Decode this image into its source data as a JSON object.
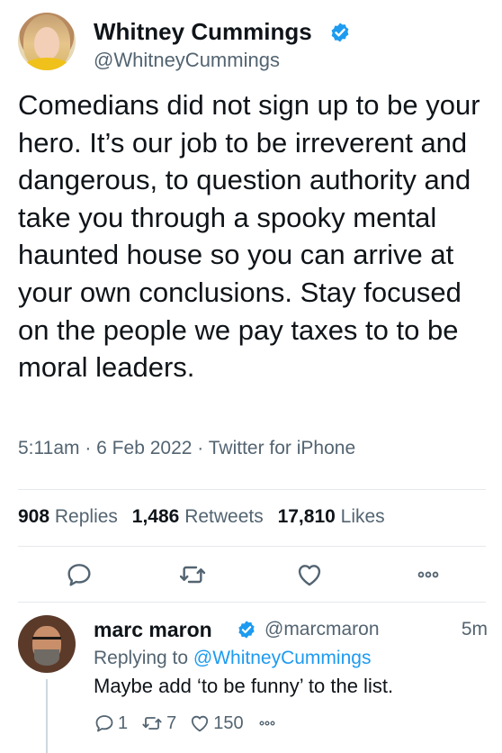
{
  "tweet": {
    "author_name": "Whitney Cummings",
    "author_handle": "@WhitneyCummings",
    "text": "Comedians did not sign up to be your hero. It’s our job to be irreverent and dangerous, to question authority and take you through a spooky mental haunted house so you can arrive at your own conclusions. Stay focused on the people we pay taxes to to be moral leaders.",
    "time": "5:11am",
    "date": "6 Feb 2022",
    "source": "Twitter for iPhone",
    "replies_count": "908",
    "replies_label": "Replies",
    "retweets_count": "1,486",
    "retweets_label": "Retweets",
    "likes_count": "17,810",
    "likes_label": "Likes"
  },
  "reply": {
    "author_name": "marc maron",
    "author_handle": "@marcmaron",
    "time": "5m",
    "replying_to_label": "Replying to",
    "replying_to_handle": "@WhitneyCummings",
    "text": "Maybe add ‘to be funny’ to the list.",
    "replies_count": "1",
    "retweets_count": "7",
    "likes_count": "150"
  },
  "icons": {
    "verified": "verified-badge-icon",
    "reply": "reply-icon",
    "retweet": "retweet-icon",
    "like": "heart-icon",
    "more": "more-icon"
  },
  "colors": {
    "accent": "#1d9bf0",
    "text_primary": "#0f1419",
    "text_secondary": "#536471",
    "divider": "#e6e9ec"
  }
}
